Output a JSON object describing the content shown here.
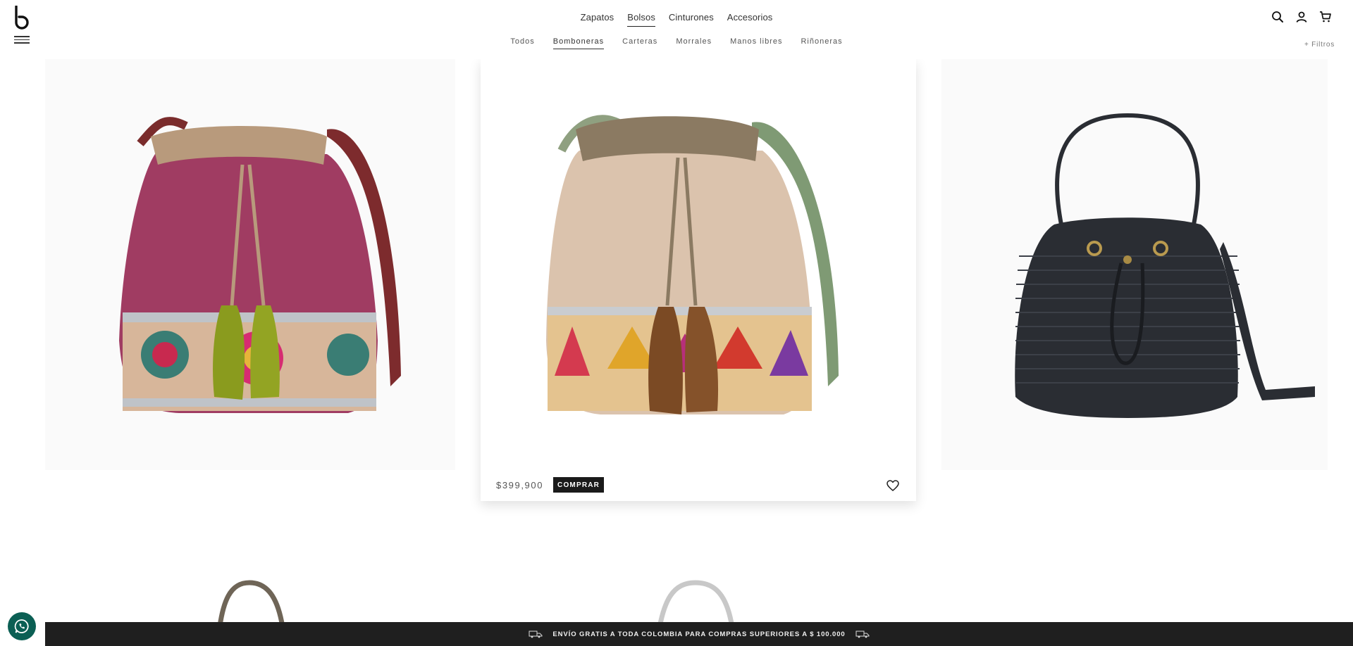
{
  "brand": {
    "logo_letter": "b"
  },
  "mainnav": [
    {
      "label": "Zapatos"
    },
    {
      "label": "Bolsos",
      "active": true
    },
    {
      "label": "Cinturones"
    },
    {
      "label": "Accesorios"
    }
  ],
  "subnav": [
    {
      "label": "Todos"
    },
    {
      "label": "Bomboneras",
      "active": true
    },
    {
      "label": "Carteras"
    },
    {
      "label": "Morrales"
    },
    {
      "label": "Manos libres"
    },
    {
      "label": "Riñoneras"
    }
  ],
  "filters_label": "+ Filtros",
  "header_icons": [
    "search-icon",
    "user-icon",
    "cart-icon"
  ],
  "products": [
    {
      "image": "bucket-bag-pink-pattern-green-tassels"
    },
    {
      "image": "bucket-bag-beige-pattern-brown-tassels",
      "price": "$399,900",
      "buy_label": "COMPRAR"
    },
    {
      "image": "bucket-bag-black-ribbed-leather"
    },
    {
      "image": "bag-taupe-handle-partial"
    },
    {
      "image": "bag-white-handle-partial"
    }
  ],
  "banner": {
    "text": "ENVÍO GRATIS A TODA COLOMBIA PARA COMPRAS SUPERIORES A $ 100.000"
  },
  "colors": {
    "banner_bg": "#1f1f1f",
    "whatsapp": "#0b5f54",
    "buy_button": "#1a1a1a"
  }
}
